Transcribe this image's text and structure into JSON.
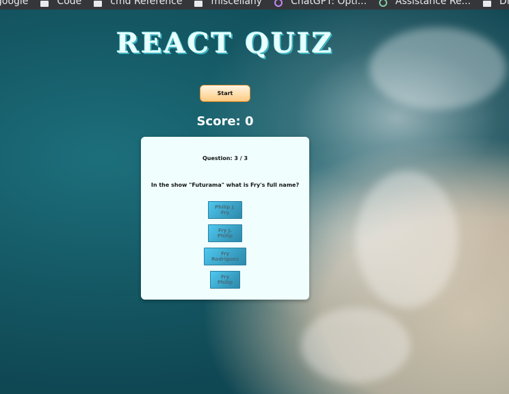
{
  "bookmarks": [
    {
      "label": "google",
      "icon": "none"
    },
    {
      "label": "Code",
      "icon": "folder-icon"
    },
    {
      "label": "cmd Reference",
      "icon": "folder-icon"
    },
    {
      "label": "miscellany",
      "icon": "folder-icon"
    },
    {
      "label": "ChatGPT: Opti...",
      "icon": "chatgpt-icon"
    },
    {
      "label": "Assistance Re...",
      "icon": "chatgpt-icon"
    },
    {
      "label": "Dmo",
      "icon": "folder-icon"
    }
  ],
  "app": {
    "title": "REACT QUIZ",
    "start_label": "Start",
    "score_text": "Score: 0"
  },
  "quiz": {
    "question_number": "Question: 3 / 3",
    "question_text": "In the show \"Futurama\" what is Fry's full name?",
    "answers": [
      "Philip J. Fry",
      "Fry J. Philip",
      "Fry Rodriguez",
      "Fry Philip"
    ]
  },
  "colors": {
    "start_button": "#ffca80",
    "card_background": "#f0fffe",
    "answer_button": "#4fc8f0"
  }
}
